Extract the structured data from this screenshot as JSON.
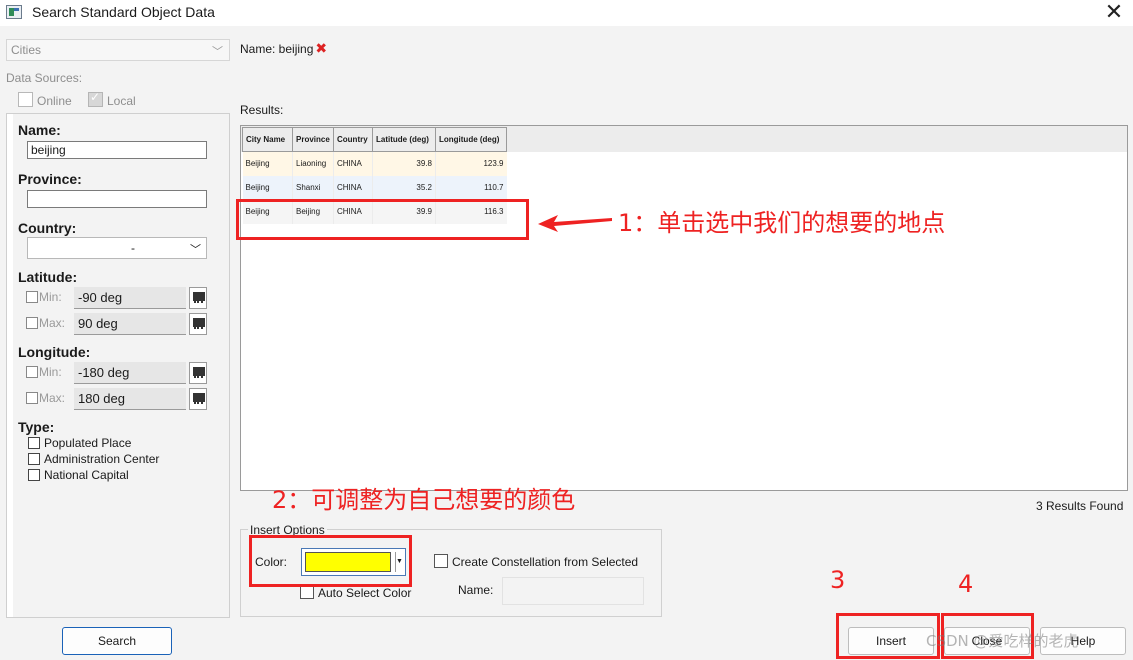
{
  "window": {
    "title": "Search Standard Object Data",
    "close_glyph": "✕"
  },
  "left": {
    "category": "Cities",
    "data_sources_label": "Data Sources:",
    "online_label": "Online",
    "local_label": "Local",
    "name_label": "Name:",
    "name_value": "beijing",
    "province_label": "Province:",
    "province_value": "",
    "country_label": "Country:",
    "country_value": "-",
    "latitude_label": "Latitude:",
    "longitude_label": "Longitude:",
    "min_label": "Min:",
    "max_label": "Max:",
    "lat_min": "-90 deg",
    "lat_max": "90 deg",
    "lon_min": "-180 deg",
    "lon_max": "180 deg",
    "type_label": "Type:",
    "types": [
      "Populated Place",
      "Administration Center",
      "National Capital"
    ],
    "search_label": "Search"
  },
  "criteria": {
    "name_text": "Name: beijing",
    "remove_glyph": "✖"
  },
  "results": {
    "label": "Results:",
    "columns": [
      "City Name",
      "Province",
      "Country",
      "Latitude (deg)",
      "Longitude (deg)"
    ],
    "rows": [
      [
        "Beijing",
        "Liaoning",
        "CHINA",
        "39.8",
        "123.9"
      ],
      [
        "Beijing",
        "Shanxi",
        "CHINA",
        "35.2",
        "110.7"
      ],
      [
        "Beijing",
        "Beijing",
        "CHINA",
        "39.9",
        "116.3"
      ]
    ],
    "count_text": "3 Results Found"
  },
  "insert_options": {
    "legend": "Insert Options",
    "color_label": "Color:",
    "color_value": "#ffff00",
    "auto_select_label": "Auto Select Color",
    "constellation_label": "Create Constellation from Selected",
    "name_label": "Name:"
  },
  "buttons": {
    "insert": "Insert",
    "close": "Close",
    "help": "Help"
  },
  "annotations": {
    "step1": "1：单击选中我们的想要的地点",
    "step2": "2：可调整为自己想要的颜色",
    "step3": "3",
    "step4": "4",
    "watermark": "CSDN @爱吃样的老虎",
    "color": "#ee2222"
  }
}
